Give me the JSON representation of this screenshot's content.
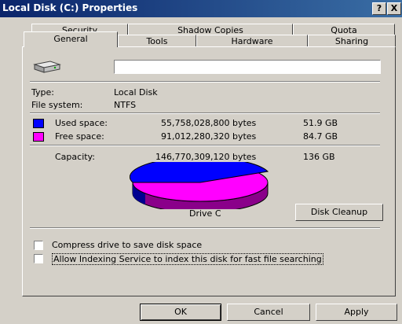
{
  "window": {
    "title": "Local Disk (C:) Properties",
    "help_button": "?",
    "close_button": "X"
  },
  "tabs_top": [
    {
      "label": "Security"
    },
    {
      "label": "Shadow Copies"
    },
    {
      "label": "Quota"
    }
  ],
  "tabs_bottom": [
    {
      "label": "General"
    },
    {
      "label": "Tools"
    },
    {
      "label": "Hardware"
    },
    {
      "label": "Sharing"
    }
  ],
  "general": {
    "drive_label_value": "",
    "type_label": "Type:",
    "type_value": "Local Disk",
    "fs_label": "File system:",
    "fs_value": "NTFS",
    "used": {
      "label": "Used space:",
      "bytes": "55,758,028,800 bytes",
      "size": "51.9 GB",
      "color": "#0000ff"
    },
    "free": {
      "label": "Free space:",
      "bytes": "91,012,280,320 bytes",
      "size": "84.7 GB",
      "color": "#ff00ff"
    },
    "capacity": {
      "label": "Capacity:",
      "bytes": "146,770,309,120 bytes",
      "size": "136 GB"
    },
    "drive_name": "Drive C",
    "cleanup_button": "Disk Cleanup",
    "compress_label": "Compress drive to save disk space",
    "index_label": "Allow Indexing Service to index this disk for fast file searching"
  },
  "footer": {
    "ok": "OK",
    "cancel": "Cancel",
    "apply": "Apply"
  }
}
